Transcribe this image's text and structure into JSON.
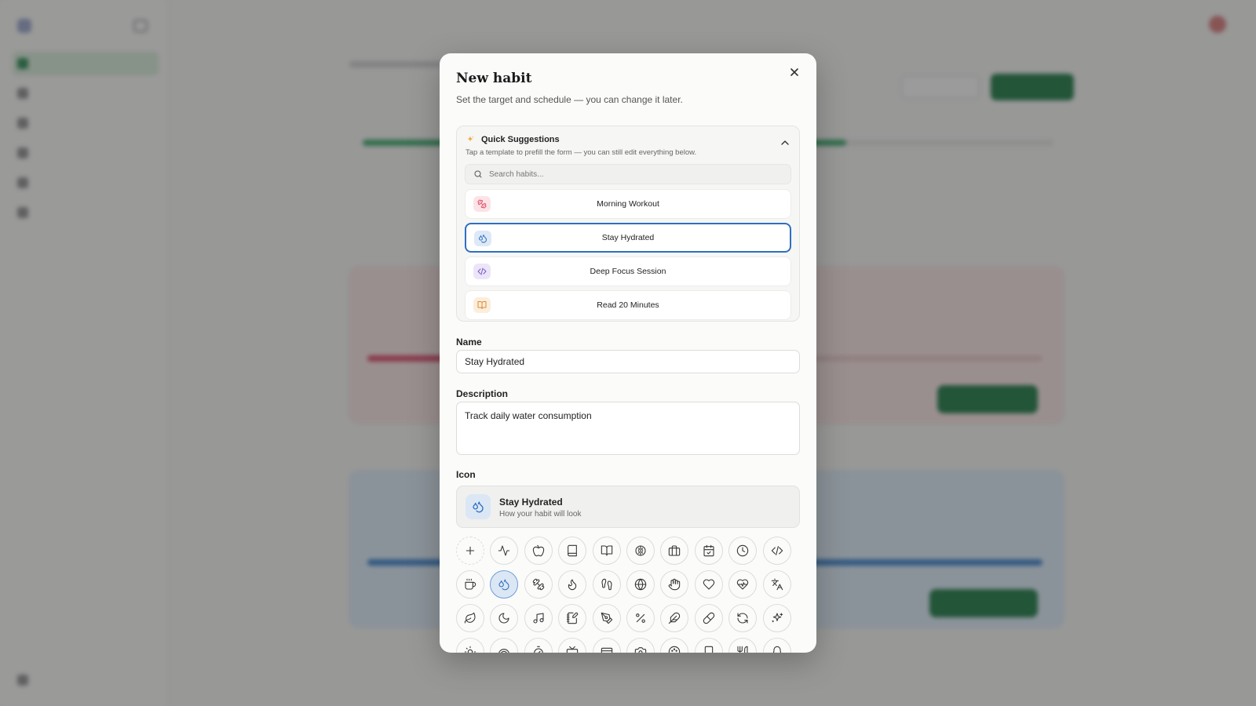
{
  "modal": {
    "title": "New habit",
    "subtitle": "Set the target and schedule — you can change it later.",
    "close_icon": "close-icon"
  },
  "suggestions": {
    "title": "Quick Suggestions",
    "hint": "Tap a template to prefill the form — you can still edit everything below.",
    "search_placeholder": "Search habits...",
    "expanded": true,
    "items": [
      {
        "label": "Morning Workout",
        "icon": "dumbbell-icon",
        "color": "#e0566b",
        "bg": "#fbe3e7",
        "selected": false
      },
      {
        "label": "Stay Hydrated",
        "icon": "droplets-icon",
        "color": "#2f6fc2",
        "bg": "#dde9f6",
        "selected": true
      },
      {
        "label": "Deep Focus Session",
        "icon": "code-icon",
        "color": "#7b55c9",
        "bg": "#ece5f8",
        "selected": false
      },
      {
        "label": "Read 20 Minutes",
        "icon": "book-open-icon",
        "color": "#e0892e",
        "bg": "#fbeedd",
        "selected": false
      }
    ]
  },
  "form": {
    "name_label": "Name",
    "name_value": "Stay Hydrated",
    "description_label": "Description",
    "description_value": "Track daily water consumption",
    "icon_label": "Icon"
  },
  "preview": {
    "name": "Stay Hydrated",
    "subtitle": "How your habit will look",
    "icon": "droplets-icon"
  },
  "icons": [
    "add-icon",
    "activity-icon",
    "apple-icon",
    "book-icon",
    "book-open-icon",
    "brain-icon",
    "briefcase-icon",
    "calendar-icon",
    "clock-icon",
    "code-icon",
    "coffee-icon",
    "droplets-icon",
    "dumbbell-icon",
    "flame-icon",
    "footprints-icon",
    "globe-icon",
    "hand-icon",
    "heart-icon",
    "heart-pulse-icon",
    "languages-icon",
    "leaf-icon",
    "moon-icon",
    "music-icon",
    "notebook-pen-icon",
    "pen-tool-icon",
    "percent-icon",
    "feather-icon",
    "pill-icon",
    "refresh-icon",
    "sparkles-icon",
    "sun-icon",
    "rainbow-icon",
    "timer-icon",
    "tv-icon",
    "wallet-icon",
    "camera-icon",
    "palette-icon",
    "smartphone-icon",
    "utensils-icon",
    "bell-icon"
  ],
  "selected_icon": "droplets-icon",
  "background": {
    "accent": "#1f7a47"
  }
}
